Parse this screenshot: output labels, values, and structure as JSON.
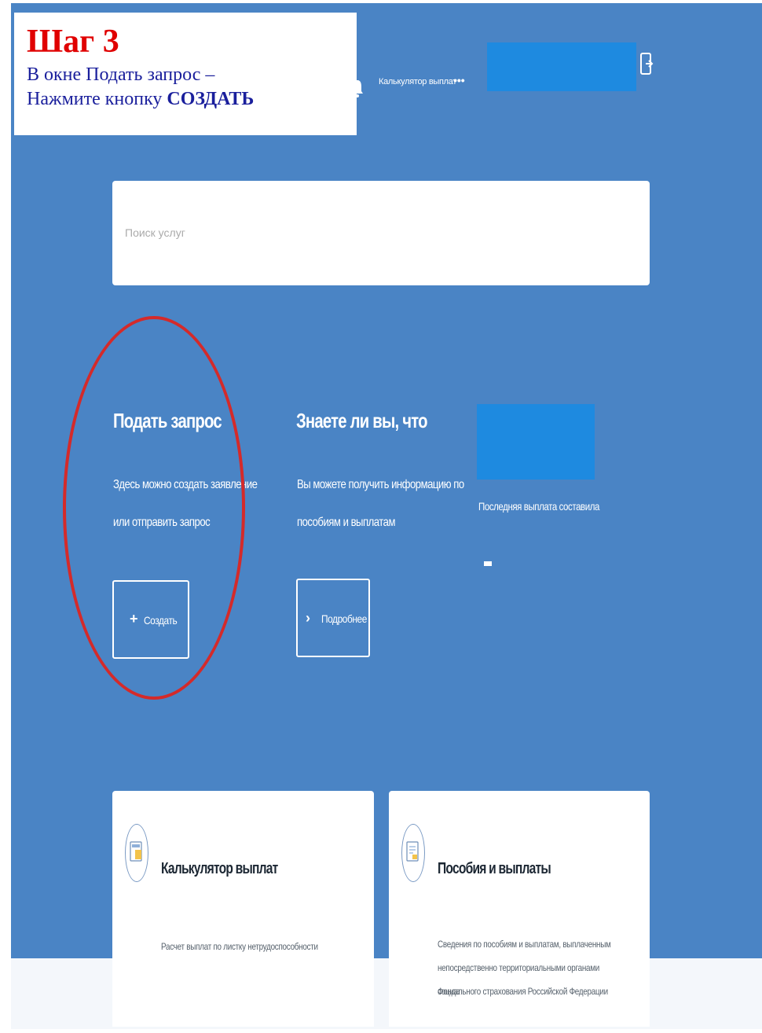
{
  "instruction": {
    "step": "Шаг 3",
    "line1": "В окне Подать запрос –",
    "line2_prefix": "Нажмите кнопку ",
    "line2_bold": "СОЗДАТЬ"
  },
  "topbar": {
    "link_label": "Калькулятор выплат",
    "more_label": "•••"
  },
  "search": {
    "placeholder": "Поиск услуг"
  },
  "request_block": {
    "title": "Подать запрос",
    "desc_line1": "Здесь можно создать заявление",
    "desc_line2": "или отправить запрос",
    "create_icon": "+",
    "create_label": "Создать"
  },
  "info_block": {
    "title": "Знаете ли вы, что",
    "desc_line1": "Вы можете получить информацию по",
    "desc_line2": "пособиям и выплатам",
    "more_icon": "›",
    "more_label": "Подробнее"
  },
  "payment_block": {
    "label": "Последняя выплата составила"
  },
  "cards": [
    {
      "title": "Калькулятор выплат",
      "desc_lines": [
        "Расчет выплат по листку нетрудоспособности"
      ]
    },
    {
      "title": "Пособия и выплаты",
      "desc_lines": [
        "Сведения по пособиям и выплатам, выплаченным",
        "непосредственно территориальными органами Фонда",
        "социального страхования Российской Федерации"
      ]
    }
  ],
  "colors": {
    "background_blue": "#4a84c5",
    "redacted_blue": "#1e8ae0",
    "highlight_red": "#d42a2a",
    "step_red": "#e00000",
    "instruction_text": "#1a1f9c"
  }
}
